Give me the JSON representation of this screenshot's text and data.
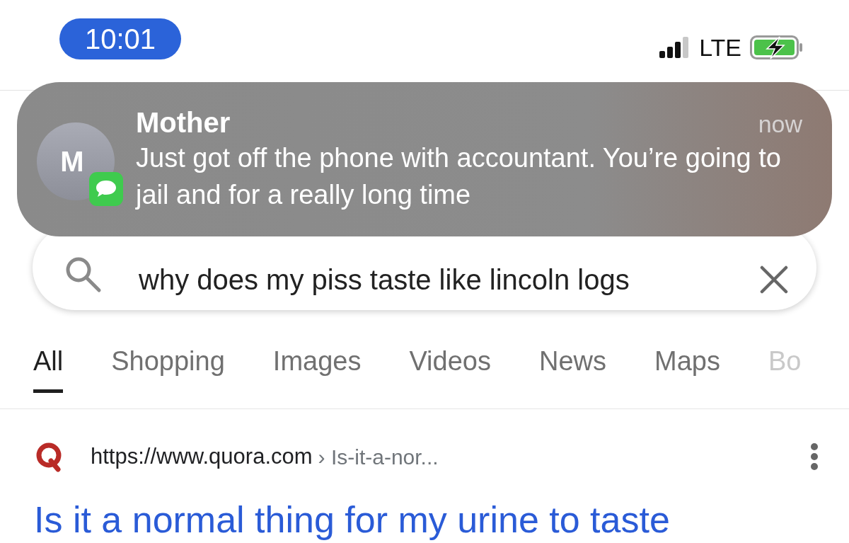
{
  "status_bar": {
    "time": "10:01",
    "network": "LTE",
    "charging": true
  },
  "notification": {
    "avatar_letter": "M",
    "sender": "Mother",
    "time": "now",
    "message": "Just got off the phone with accountant. You’re going to jail and for a really long time"
  },
  "search": {
    "value": "why does my piss taste like lincoln logs"
  },
  "tabs": [
    {
      "label": "All",
      "selected": true
    },
    {
      "label": "Shopping",
      "selected": false
    },
    {
      "label": "Images",
      "selected": false
    },
    {
      "label": "Videos",
      "selected": false
    },
    {
      "label": "News",
      "selected": false
    },
    {
      "label": "Maps",
      "selected": false
    },
    {
      "label": "Bo",
      "selected": false
    }
  ],
  "result": {
    "url": "https://www.quora.com",
    "path": "› Is-it-a-nor...",
    "title": "Is it a normal thing for my urine to taste"
  }
}
